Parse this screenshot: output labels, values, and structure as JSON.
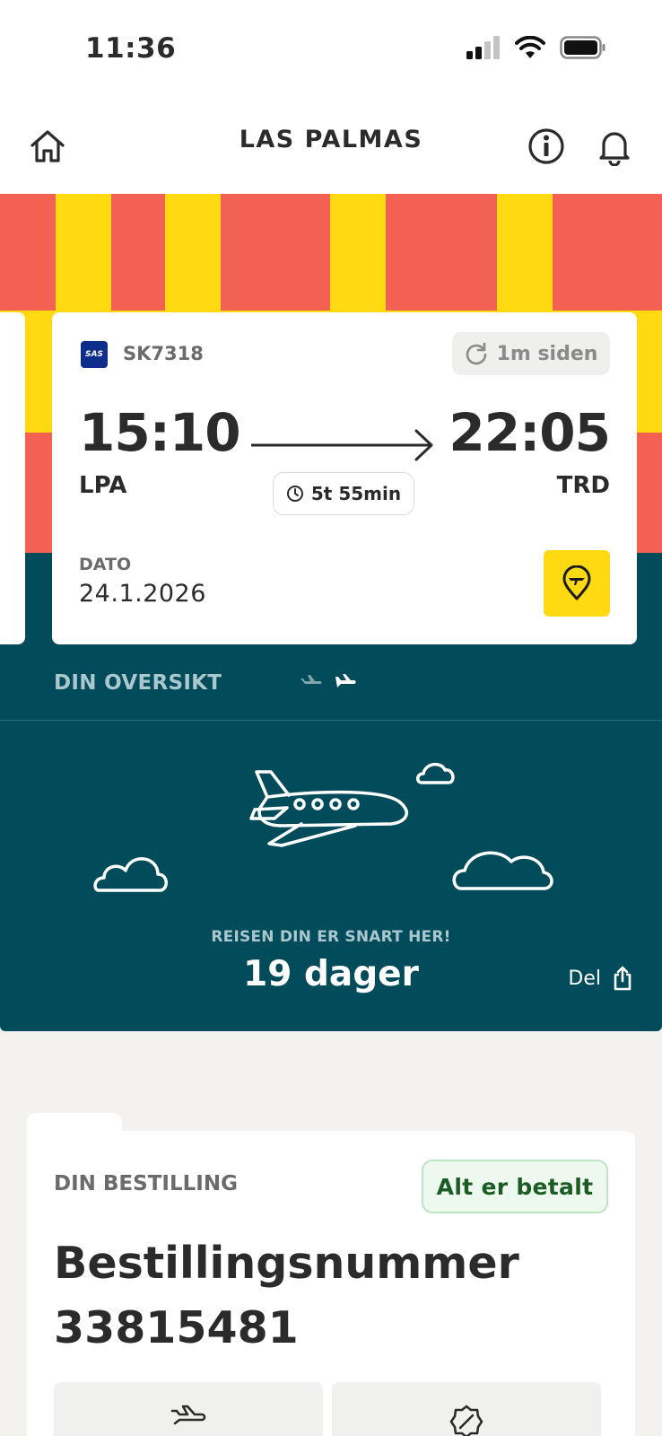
{
  "status_bar": {
    "time": "11:36"
  },
  "nav": {
    "title": "LAS PALMAS"
  },
  "colors": {
    "stripe_red": "#f26152",
    "stripe_yellow": "#ffd912",
    "teal": "#024b5b",
    "paid_green": "#1a5c24"
  },
  "flight": {
    "airline_logo": "SAS",
    "flight_number": "SK7318",
    "updated": "1m siden",
    "departure_time": "15:10",
    "departure_code": "LPA",
    "arrival_time": "22:05",
    "arrival_code": "TRD",
    "duration": "5t 55min",
    "date_label": "DATO",
    "date_value": "24.1.2026"
  },
  "overview": {
    "label": "DIN OVERSIKT",
    "countdown_label": "REISEN DIN ER SNART HER!",
    "countdown_value": "19 dager",
    "share_label": "Del"
  },
  "booking": {
    "label": "DIN BESTILLING",
    "status_badge": "Alt er betalt",
    "title_line1": "Bestillingsnummer",
    "title_line2": "33815481"
  },
  "icons": [
    "home-icon",
    "info-icon",
    "bell-icon",
    "refresh-icon",
    "clock-icon",
    "map-pin-icon",
    "plane-icon",
    "share-icon",
    "badge-icon"
  ]
}
